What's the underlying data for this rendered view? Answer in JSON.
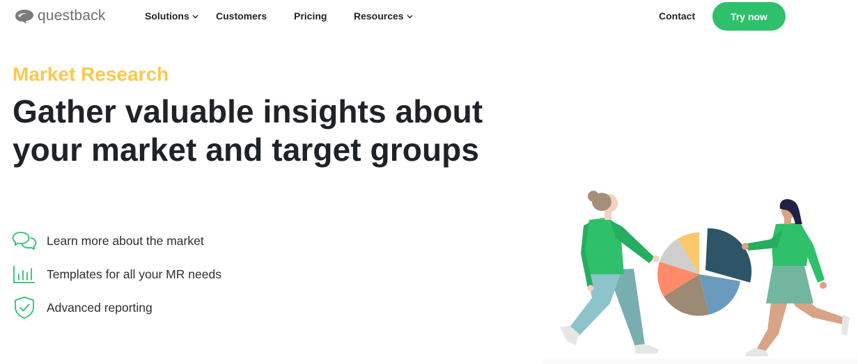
{
  "brand": {
    "name": "questback",
    "color": "#2ec06a"
  },
  "nav": {
    "items": [
      {
        "label": "Solutions",
        "has_dropdown": true
      },
      {
        "label": "Customers",
        "has_dropdown": false
      },
      {
        "label": "Pricing",
        "has_dropdown": false
      },
      {
        "label": "Resources",
        "has_dropdown": true
      }
    ],
    "contact_label": "Contact",
    "cta_label": "Try now"
  },
  "hero": {
    "eyebrow": "Market Research",
    "headline_line1": "Gather valuable insights about",
    "headline_line2": "your market and target groups",
    "eyebrow_color": "#fcc84e"
  },
  "features": [
    {
      "icon": "chat-bubbles-icon",
      "label": "Learn more about the market"
    },
    {
      "icon": "bar-chart-icon",
      "label": "Templates for all your MR needs"
    },
    {
      "icon": "shield-check-icon",
      "label": "Advanced reporting"
    }
  ],
  "illustration": {
    "icon": "people-with-pie-chart-illustration",
    "pie_colors": [
      "#2d5567",
      "#6a9bbf",
      "#9c8a74",
      "#ff8b6a",
      "#cfcfcf",
      "#fcc86b"
    ]
  }
}
